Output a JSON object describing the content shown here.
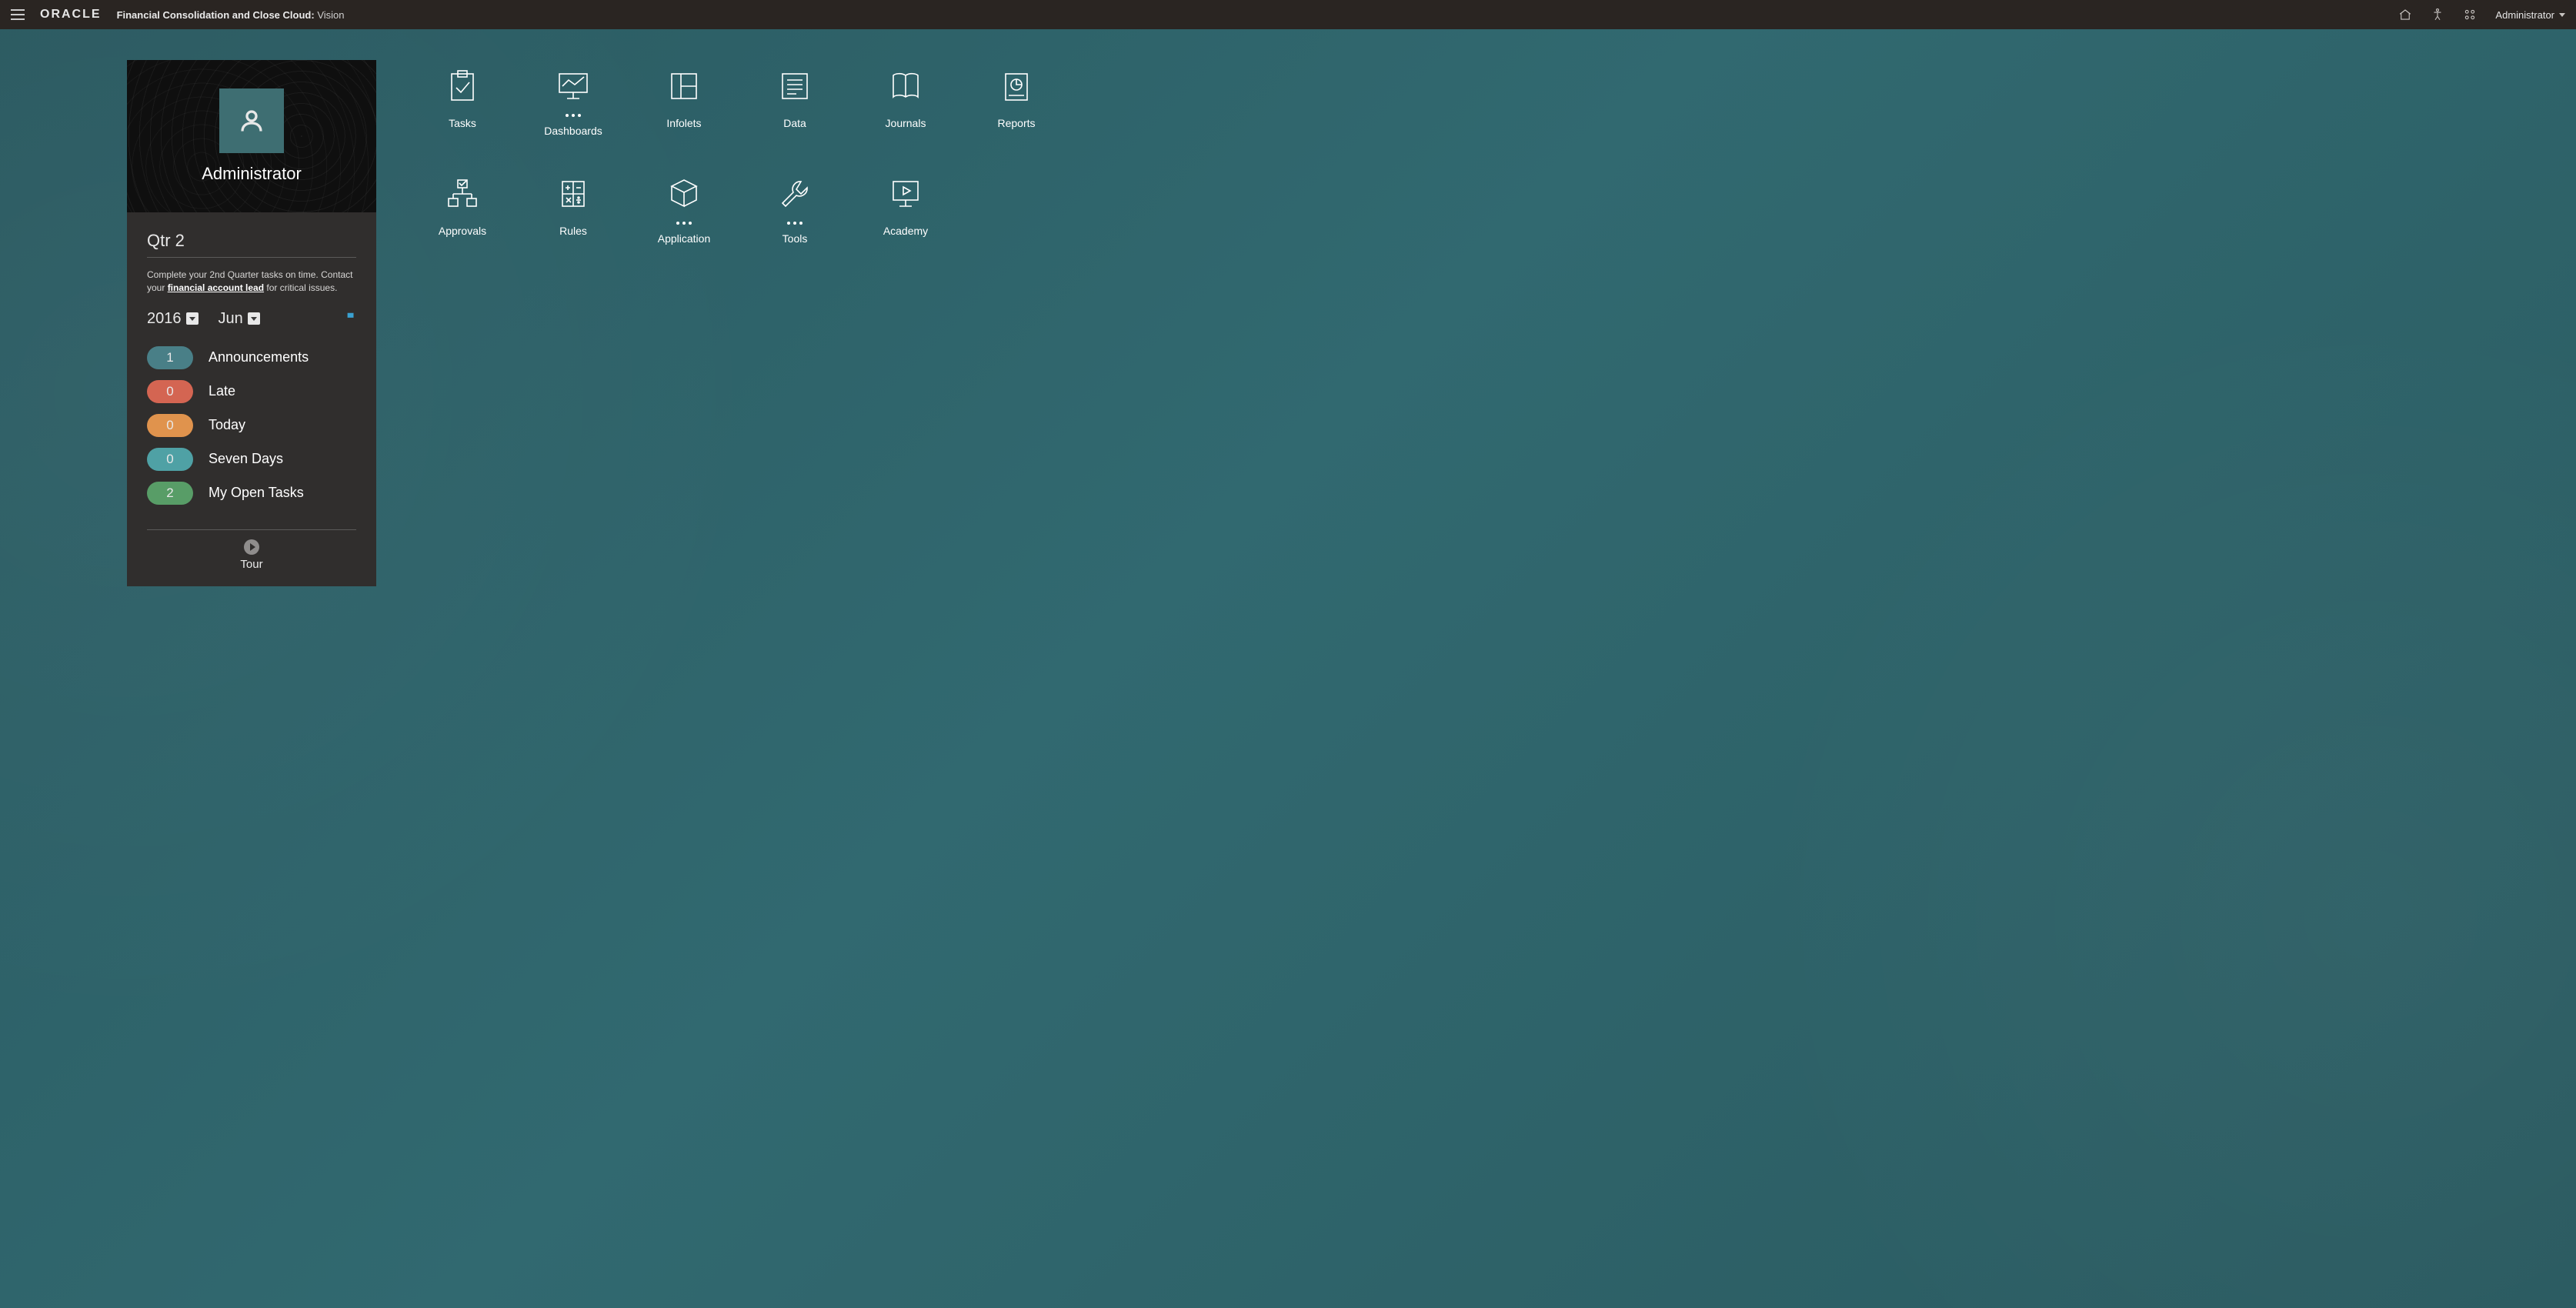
{
  "header": {
    "logo_text": "ORACLE",
    "app_name": "Financial Consolidation and Close Cloud:",
    "instance": "Vision",
    "user": "Administrator"
  },
  "panel": {
    "username": "Administrator",
    "quarter_title": "Qtr 2",
    "message_pre": "Complete your 2nd Quarter tasks on time. Contact your ",
    "message_link": "financial account lead",
    "message_post": " for critical issues.",
    "year": "2016",
    "month": "Jun",
    "stats": [
      {
        "count": "1",
        "label": "Announcements",
        "color": "blue"
      },
      {
        "count": "0",
        "label": "Late",
        "color": "red"
      },
      {
        "count": "0",
        "label": "Today",
        "color": "orange"
      },
      {
        "count": "0",
        "label": "Seven Days",
        "color": "teal"
      },
      {
        "count": "2",
        "label": "My Open Tasks",
        "color": "green"
      }
    ],
    "tour_label": "Tour"
  },
  "tiles": [
    {
      "id": "tasks",
      "label": "Tasks",
      "icon": "clipboard-check-icon",
      "dots": false
    },
    {
      "id": "dashboards",
      "label": "Dashboards",
      "icon": "monitor-chart-icon",
      "dots": true
    },
    {
      "id": "infolets",
      "label": "Infolets",
      "icon": "panel-layout-icon",
      "dots": false
    },
    {
      "id": "data",
      "label": "Data",
      "icon": "list-lines-icon",
      "dots": false
    },
    {
      "id": "journals",
      "label": "Journals",
      "icon": "open-book-icon",
      "dots": false
    },
    {
      "id": "reports",
      "label": "Reports",
      "icon": "pie-document-icon",
      "dots": false
    },
    {
      "id": "approvals",
      "label": "Approvals",
      "icon": "org-check-icon",
      "dots": false
    },
    {
      "id": "rules",
      "label": "Rules",
      "icon": "calculator-icon",
      "dots": false
    },
    {
      "id": "application",
      "label": "Application",
      "icon": "cube-icon",
      "dots": true
    },
    {
      "id": "tools",
      "label": "Tools",
      "icon": "wrench-icon",
      "dots": true
    },
    {
      "id": "academy",
      "label": "Academy",
      "icon": "play-monitor-icon",
      "dots": false
    }
  ]
}
